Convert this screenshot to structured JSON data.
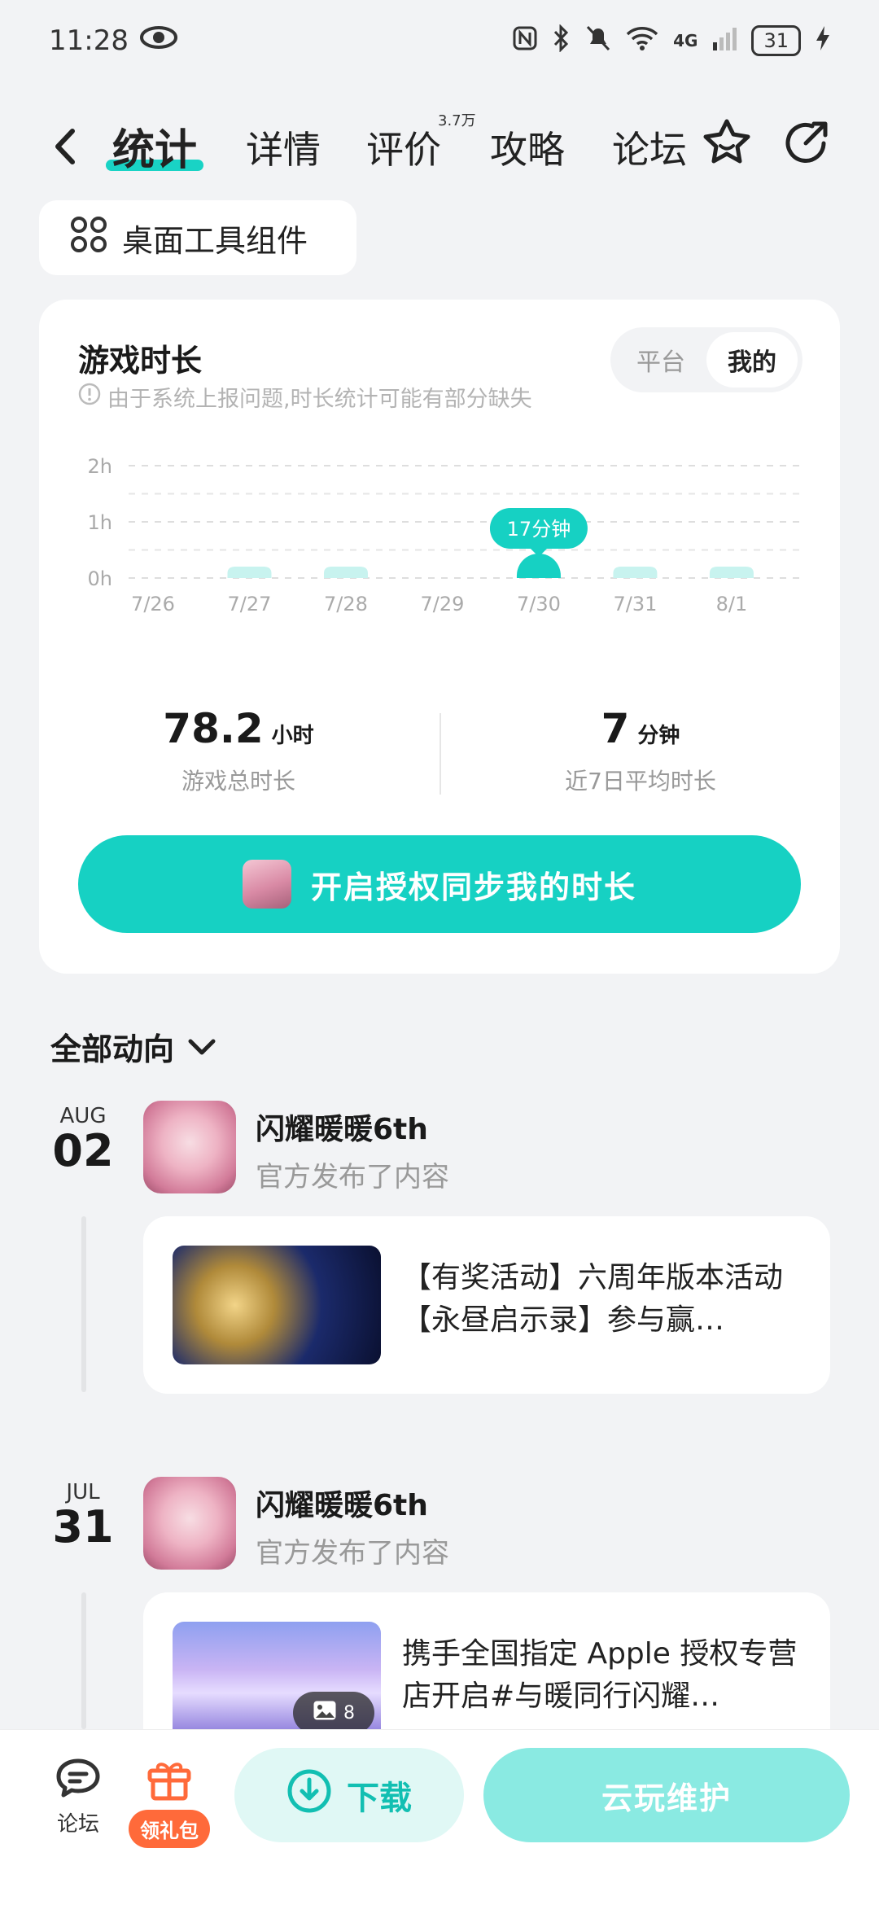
{
  "status_bar": {
    "time": "11:28",
    "network": "4G",
    "battery": "31"
  },
  "nav": {
    "tabs": [
      {
        "label": "统计"
      },
      {
        "label": "详情"
      },
      {
        "label": "评价"
      },
      {
        "label": "攻略"
      },
      {
        "label": "论坛"
      }
    ],
    "review_count_badge": "3.7万"
  },
  "widget_pill": {
    "label": "桌面工具组件"
  },
  "stats_card": {
    "title": "游戏时长",
    "note": "由于系统上报问题,时长统计可能有部分缺失",
    "segment": [
      "平台",
      "我的"
    ],
    "total": {
      "value": "78.2",
      "unit": "小时",
      "label": "游戏总时长"
    },
    "average": {
      "value": "7",
      "unit": "分钟",
      "label": "近7日平均时长"
    },
    "sync_button": "开启授权同步我的时长"
  },
  "chart_data": {
    "type": "bar",
    "categories": [
      "7/26",
      "7/27",
      "7/28",
      "7/29",
      "7/30",
      "7/31",
      "8/1"
    ],
    "values": [
      0,
      0,
      0,
      0,
      17,
      0,
      0
    ],
    "y_ticks": [
      "0h",
      "1h",
      "2h"
    ],
    "y_tick_values": [
      0,
      60,
      120
    ],
    "ylim": [
      0,
      120
    ],
    "highlight_label": "17分钟",
    "highlight_index": 4,
    "grid": true,
    "bar_color": "#16d1c3",
    "empty_bar_color": "#c8f3ef"
  },
  "feed": {
    "filter_label": "全部动向",
    "entries": [
      {
        "month": "AUG",
        "day": "02",
        "name": "闪耀暖暖6th",
        "sub": "官方发布了内容",
        "post_text": "【有奖活动】六周年版本活动【永昼启示录】参与赢…"
      },
      {
        "month": "JUL",
        "day": "31",
        "name": "闪耀暖暖6th",
        "sub": "官方发布了内容",
        "post_text": "携手全国指定 Apple 授权专营店开启#与暖同行闪耀…",
        "image_count": "8"
      }
    ]
  },
  "bottom_bar": {
    "forum_label": "论坛",
    "gift_label": "领礼包",
    "download_label": "下载",
    "cloud_label": "云玩维护"
  }
}
